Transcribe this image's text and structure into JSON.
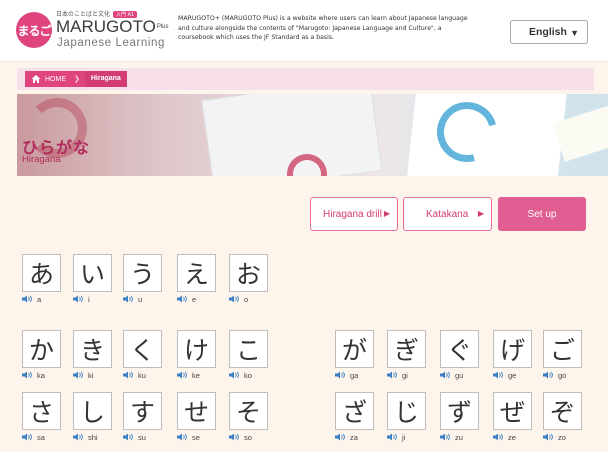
{
  "header": {
    "logo_mark": "まるご",
    "logo_sub": "日本のことばと文化",
    "logo_badge": "入門 A1",
    "logo_title": "MARUGOTO",
    "logo_plus": "Plus",
    "logo_subtitle": "Japanese Learning",
    "description": "MARUGOTO+ (MARUGOTO Plus) is a website where users can learn about Japanese language and culture alongside the contents of \"Marugoto: Japanese Language and Culture\", a coursebook which uses the JF Standard as a basis.",
    "language": "English"
  },
  "breadcrumb": {
    "home": "HOME",
    "current": "Hiragana"
  },
  "hero": {
    "title": "ひらがな",
    "subtitle": "Hiragana"
  },
  "buttons": {
    "drill": "Hiragana drill",
    "katakana": "Katakana",
    "setup": "Set up"
  },
  "colors": {
    "accent": "#e0447f",
    "accent_light": "#f8e0ea",
    "background": "#fdf4ec"
  },
  "kana_rows": [
    {
      "left": [
        {
          "char": "あ",
          "romaji": "a"
        },
        {
          "char": "い",
          "romaji": "i"
        },
        {
          "char": "う",
          "romaji": "u"
        },
        {
          "char": "え",
          "romaji": "e"
        },
        {
          "char": "お",
          "romaji": "o"
        }
      ],
      "right": []
    },
    {
      "left": [
        {
          "char": "か",
          "romaji": "ka"
        },
        {
          "char": "き",
          "romaji": "ki"
        },
        {
          "char": "く",
          "romaji": "ku"
        },
        {
          "char": "け",
          "romaji": "ke"
        },
        {
          "char": "こ",
          "romaji": "ko"
        }
      ],
      "right": [
        {
          "char": "が",
          "romaji": "ga"
        },
        {
          "char": "ぎ",
          "romaji": "gi"
        },
        {
          "char": "ぐ",
          "romaji": "gu"
        },
        {
          "char": "げ",
          "romaji": "ge"
        },
        {
          "char": "ご",
          "romaji": "go"
        }
      ]
    },
    {
      "left": [
        {
          "char": "さ",
          "romaji": "sa"
        },
        {
          "char": "し",
          "romaji": "shi"
        },
        {
          "char": "す",
          "romaji": "su"
        },
        {
          "char": "せ",
          "romaji": "se"
        },
        {
          "char": "そ",
          "romaji": "so"
        }
      ],
      "right": [
        {
          "char": "ざ",
          "romaji": "za"
        },
        {
          "char": "じ",
          "romaji": "ji"
        },
        {
          "char": "ず",
          "romaji": "zu"
        },
        {
          "char": "ぜ",
          "romaji": "ze"
        },
        {
          "char": "ぞ",
          "romaji": "zo"
        }
      ]
    }
  ]
}
